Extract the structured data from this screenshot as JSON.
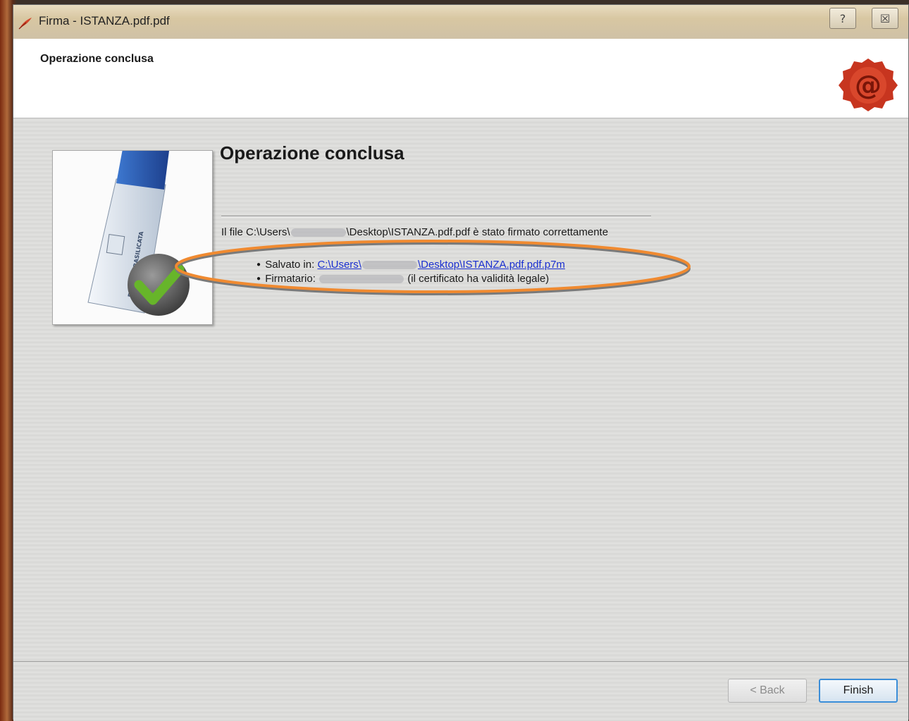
{
  "window": {
    "title": "Firma - ISTANZA.pdf.pdf",
    "help_label": "?",
    "close_label": "☒"
  },
  "header": {
    "title": "Operazione conclusa",
    "seal_glyph": "@",
    "seal_color": "#c7351f"
  },
  "main": {
    "title": "Operazione conclusa",
    "status": {
      "prefix": "Il file C:\\Users\\",
      "middle": "\\Desktop\\ISTANZA.pdf.pdf è stato firmato correttamente"
    },
    "saved_in": {
      "label": "Salvato in:",
      "link_prefix": "C:\\Users\\",
      "link_suffix": "\\Desktop\\ISTANZA.pdf.pdf.p7m"
    },
    "signer": {
      "label": "Firmatario:",
      "note": "(il certificato ha validità legale)"
    },
    "illustration": {
      "token_text": "REGIONE BASILICATA",
      "highlight_color": "#f08a30"
    }
  },
  "footer": {
    "back_label": "< Back",
    "finish_label": "Finish"
  }
}
